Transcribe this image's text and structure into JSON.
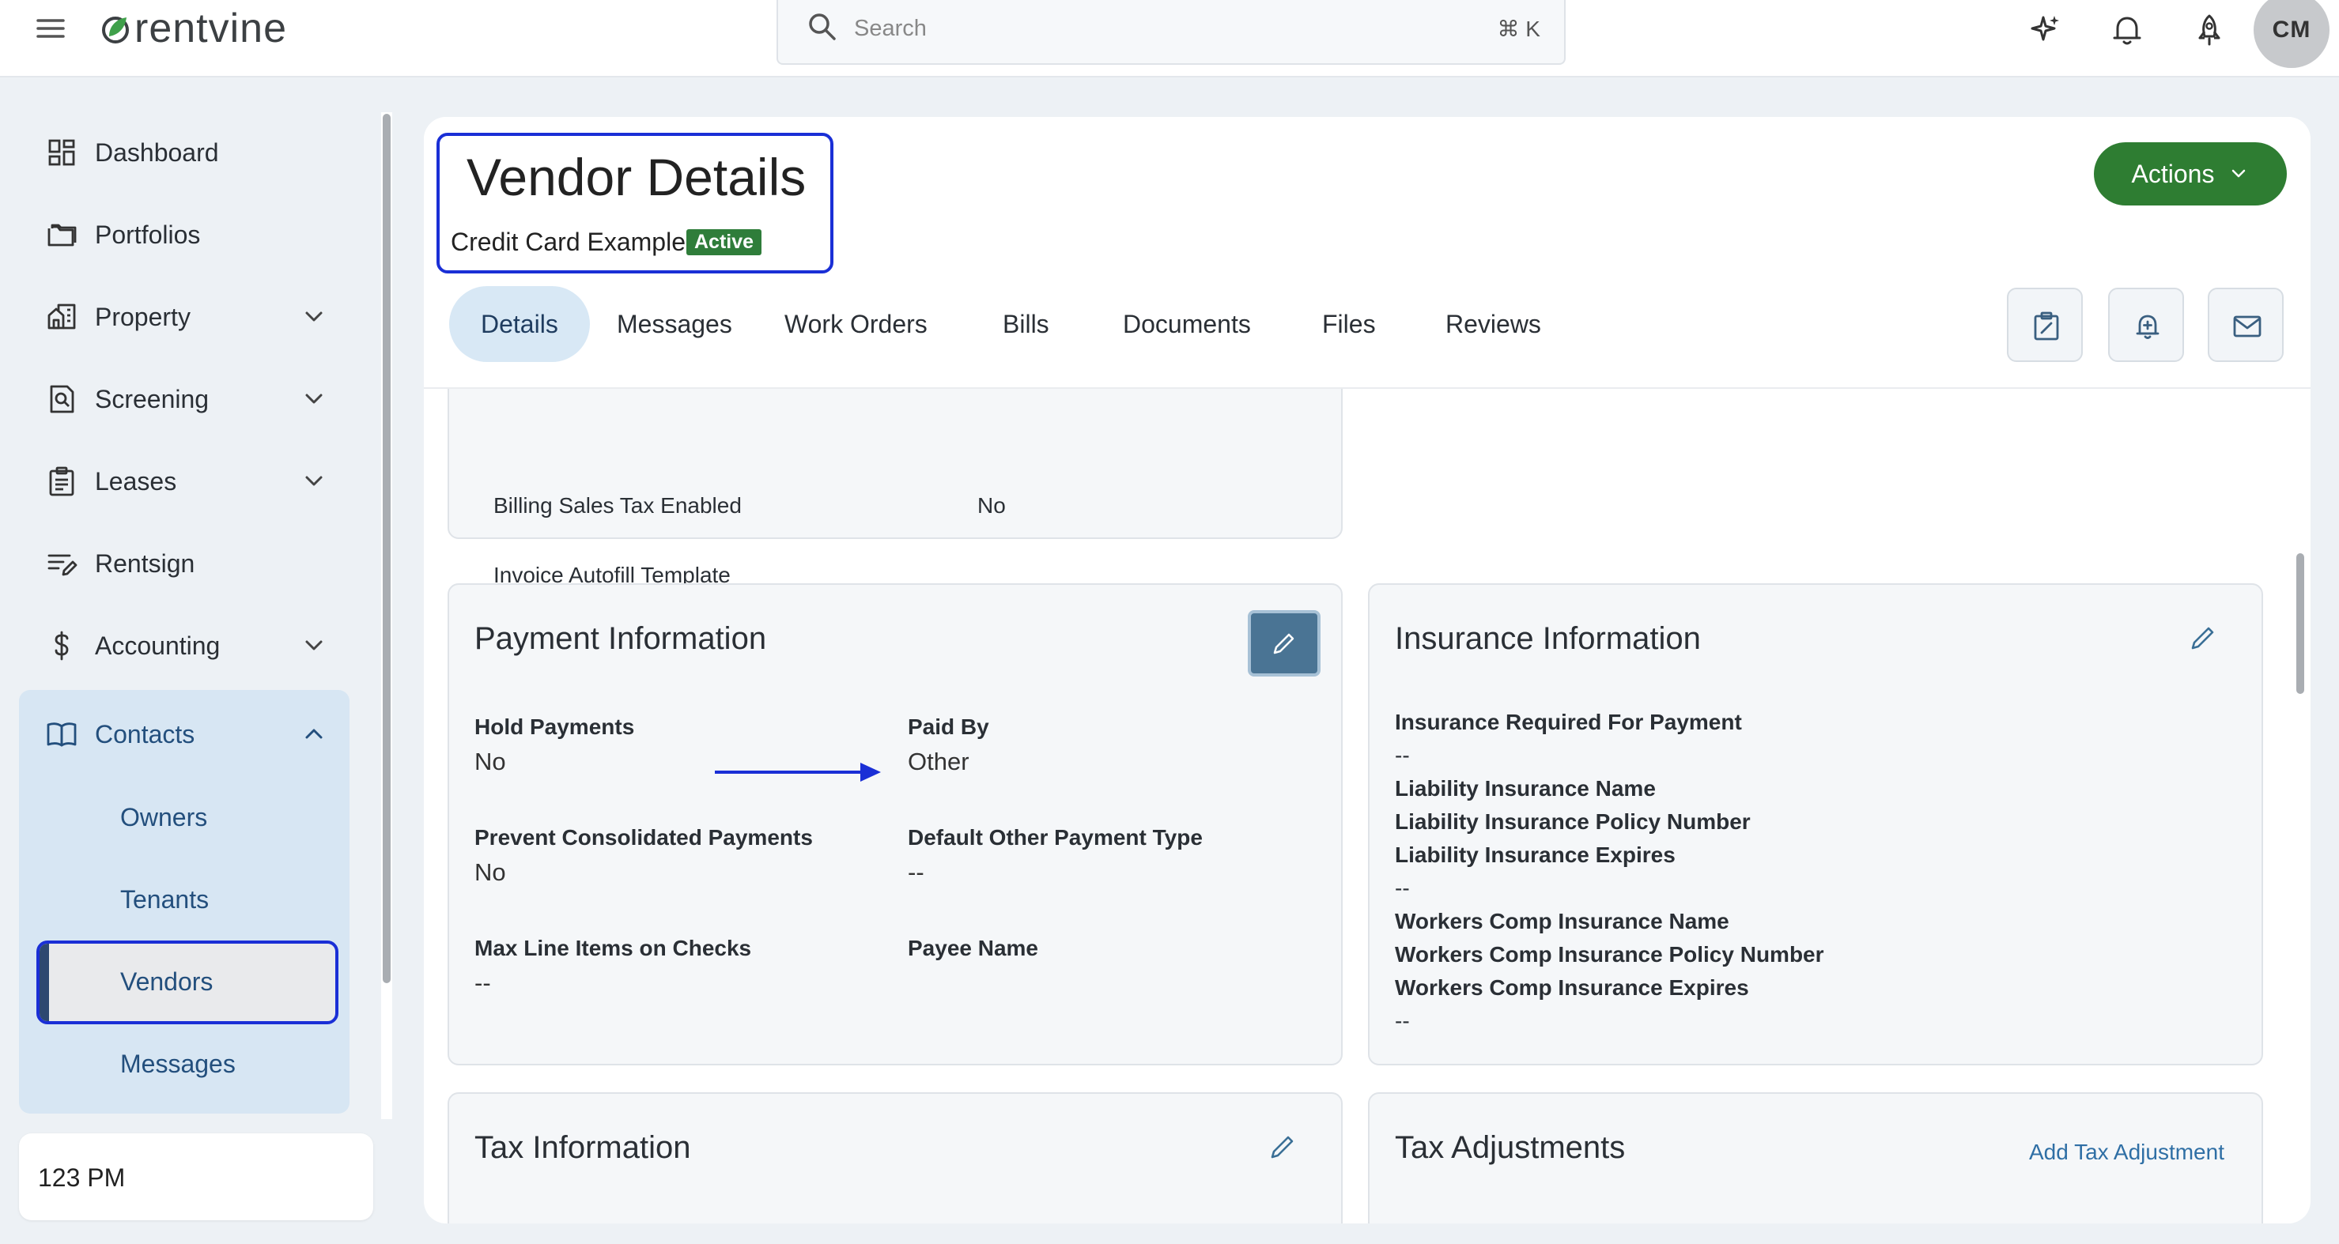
{
  "app": {
    "logo_text": "rentvine",
    "colors": {
      "brand_green": "#2e7d32",
      "highlight_blue": "#1a2fd6",
      "nav_text": "#234f7d"
    }
  },
  "topbar": {
    "search_placeholder": "Search",
    "search_shortcut": "⌘ K",
    "avatar_initials": "CM",
    "icons": [
      "menu-icon",
      "sparkle-icon",
      "bell-icon",
      "rocket-icon"
    ]
  },
  "sidebar": {
    "items": [
      {
        "label": "Dashboard",
        "icon": "dashboard-icon"
      },
      {
        "label": "Portfolios",
        "icon": "folder-icon"
      },
      {
        "label": "Property",
        "icon": "building-icon"
      },
      {
        "label": "Screening",
        "icon": "screening-icon"
      },
      {
        "label": "Leases",
        "icon": "clipboard-icon"
      },
      {
        "label": "Rentsign",
        "icon": "sign-icon"
      },
      {
        "label": "Accounting",
        "icon": "dollar-icon"
      },
      {
        "label": "Contacts",
        "icon": "book-icon"
      }
    ],
    "contacts_sub": [
      {
        "label": "Owners"
      },
      {
        "label": "Tenants"
      },
      {
        "label": "Vendors"
      },
      {
        "label": "Messages"
      }
    ],
    "time_text": "123 PM"
  },
  "page": {
    "title": "Vendor Details",
    "vendor_name": "Credit Card Example",
    "status": "Active",
    "actions_label": "Actions",
    "tabs": [
      "Details",
      "Messages",
      "Work Orders",
      "Bills",
      "Documents",
      "Files",
      "Reviews"
    ],
    "tab_icons": [
      "edit-note-icon",
      "bell-plus-icon",
      "mail-icon"
    ]
  },
  "top_card": {
    "cut_label": "Billing Sales Tax Enabled",
    "cut_value": "No",
    "invoice_label": "Invoice Autofill Template"
  },
  "payment": {
    "title": "Payment Information",
    "fields": [
      {
        "label": "Hold Payments",
        "value": "No"
      },
      {
        "label": "Paid By",
        "value": "Other"
      },
      {
        "label": "Prevent Consolidated Payments",
        "value": "No"
      },
      {
        "label": "Default Other Payment Type",
        "value": "--"
      },
      {
        "label": "Max Line Items on Checks",
        "value": "--"
      },
      {
        "label": "Payee Name",
        "value": ""
      }
    ]
  },
  "insurance": {
    "title": "Insurance Information",
    "lines": [
      {
        "text": "Insurance Required For Payment",
        "bold": true
      },
      {
        "text": "--",
        "bold": false
      },
      {
        "text": "Liability Insurance Name",
        "bold": true
      },
      {
        "text": "Liability Insurance Policy Number",
        "bold": true
      },
      {
        "text": "Liability Insurance Expires",
        "bold": true
      },
      {
        "text": "--",
        "bold": false
      },
      {
        "text": "Workers Comp Insurance Name",
        "bold": true
      },
      {
        "text": "Workers Comp Insurance Policy Number",
        "bold": true
      },
      {
        "text": "Workers Comp Insurance Expires",
        "bold": true
      },
      {
        "text": "--",
        "bold": false
      }
    ]
  },
  "tax_info": {
    "title": "Tax Information"
  },
  "tax_adjustments": {
    "title": "Tax Adjustments",
    "add_link": "Add Tax Adjustment"
  }
}
